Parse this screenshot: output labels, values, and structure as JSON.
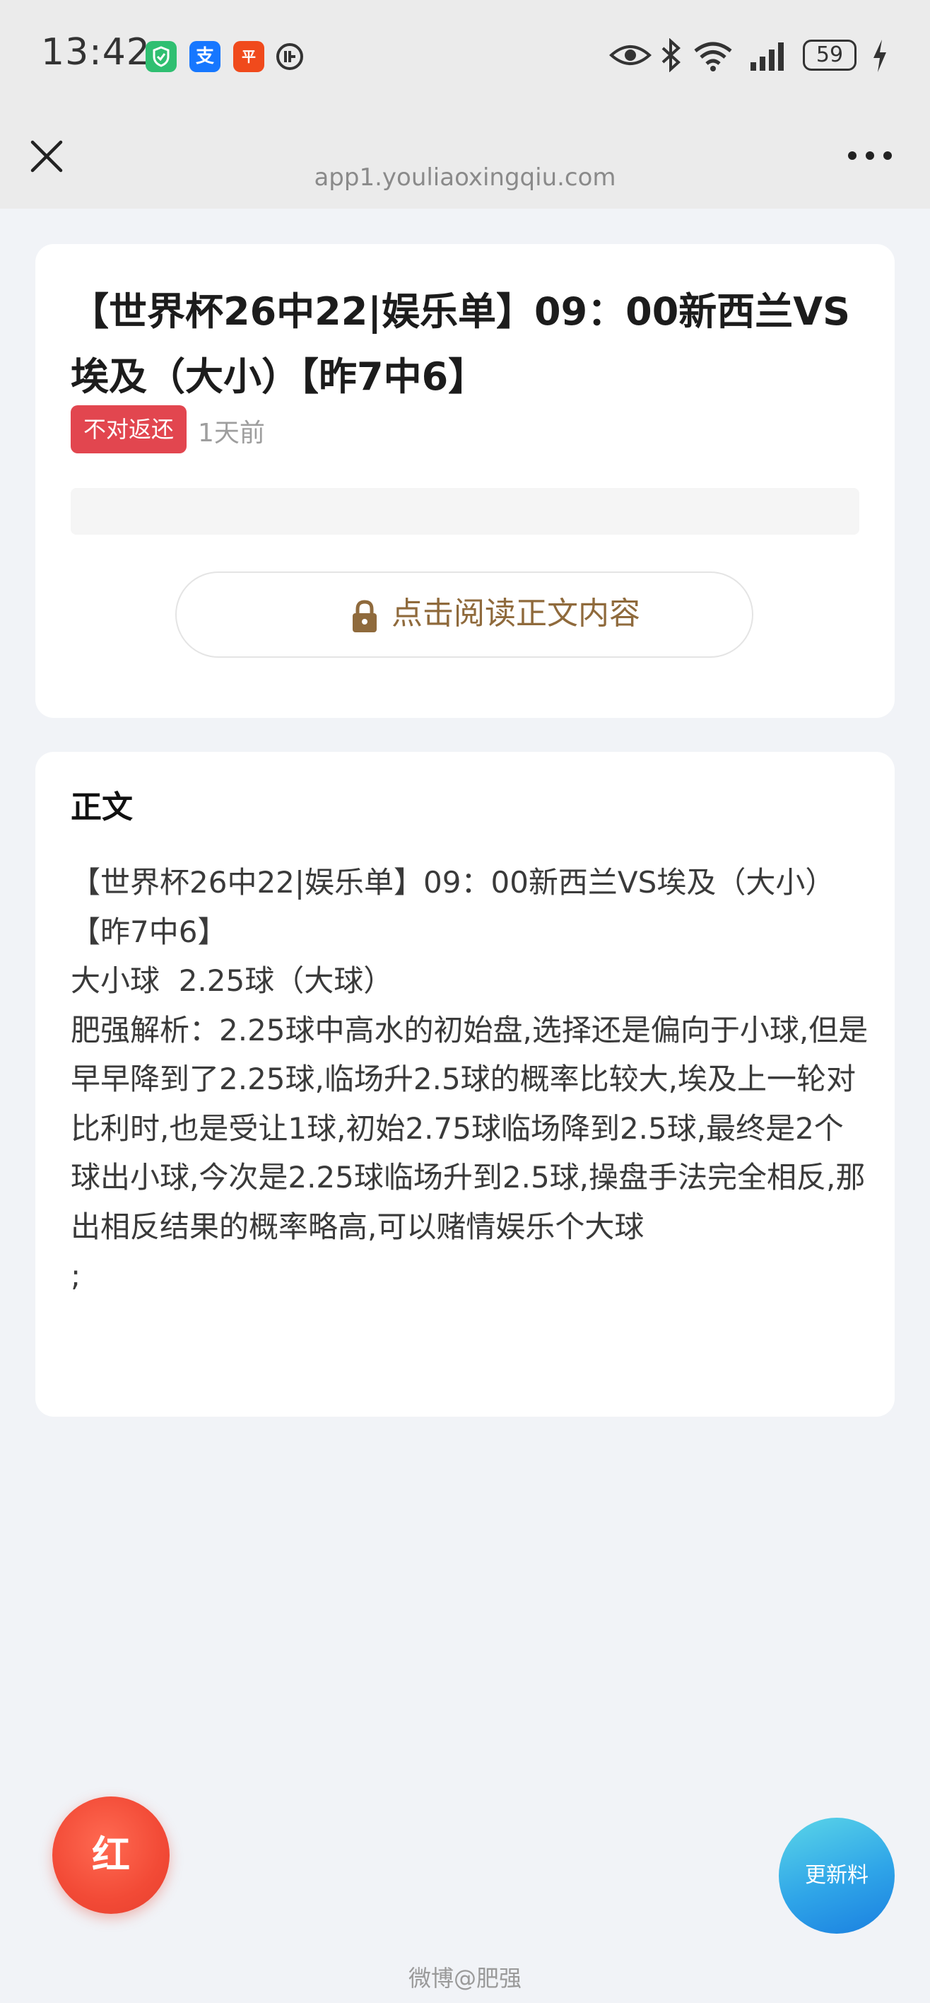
{
  "status_bar": {
    "time": "13:42",
    "battery": "59",
    "app_icons": [
      {
        "name": "wechat-pay-icon",
        "color": "#2fbf71",
        "glyph": "✓"
      },
      {
        "name": "alipay-icon",
        "color": "#1677ff",
        "glyph": "支"
      },
      {
        "name": "pingan-bank-icon",
        "color": "#f04a1c",
        "glyph": "平"
      },
      {
        "name": "app-icon",
        "color": "#333333",
        "glyph": "◔"
      }
    ]
  },
  "nav": {
    "url": "app1.youliaoxingqiu.com"
  },
  "article": {
    "title": "【世界杯26中22|娱乐单】09：00新西兰VS埃及（大小）【昨7中6】",
    "badge": "不对返还",
    "time_ago": "1天前",
    "read_button": "点击阅读正文内容"
  },
  "body": {
    "heading": "正文",
    "lines": [
      "【世界杯26中22|娱乐单】09：00新西兰VS埃及（大小）【昨7中6】",
      "大小球  2.25球（大球）",
      "肥强解析：2.25球中高水的初始盘,选择还是偏向于小球,但是早早降到了2.25球,临场升2.5球的概率比较大,埃及上一轮对比利时,也是受让1球,初始2.75球临场降到2.5球,最终是2个球出小球,今次是2.25球临场升到2.5球,操盘手法完全相反,那出相反结果的概率略高,可以赌情娱乐个大球",
      ";"
    ]
  },
  "fab": {
    "red_label": "红",
    "update_label": "更新料"
  },
  "watermark": "微博@肥强"
}
